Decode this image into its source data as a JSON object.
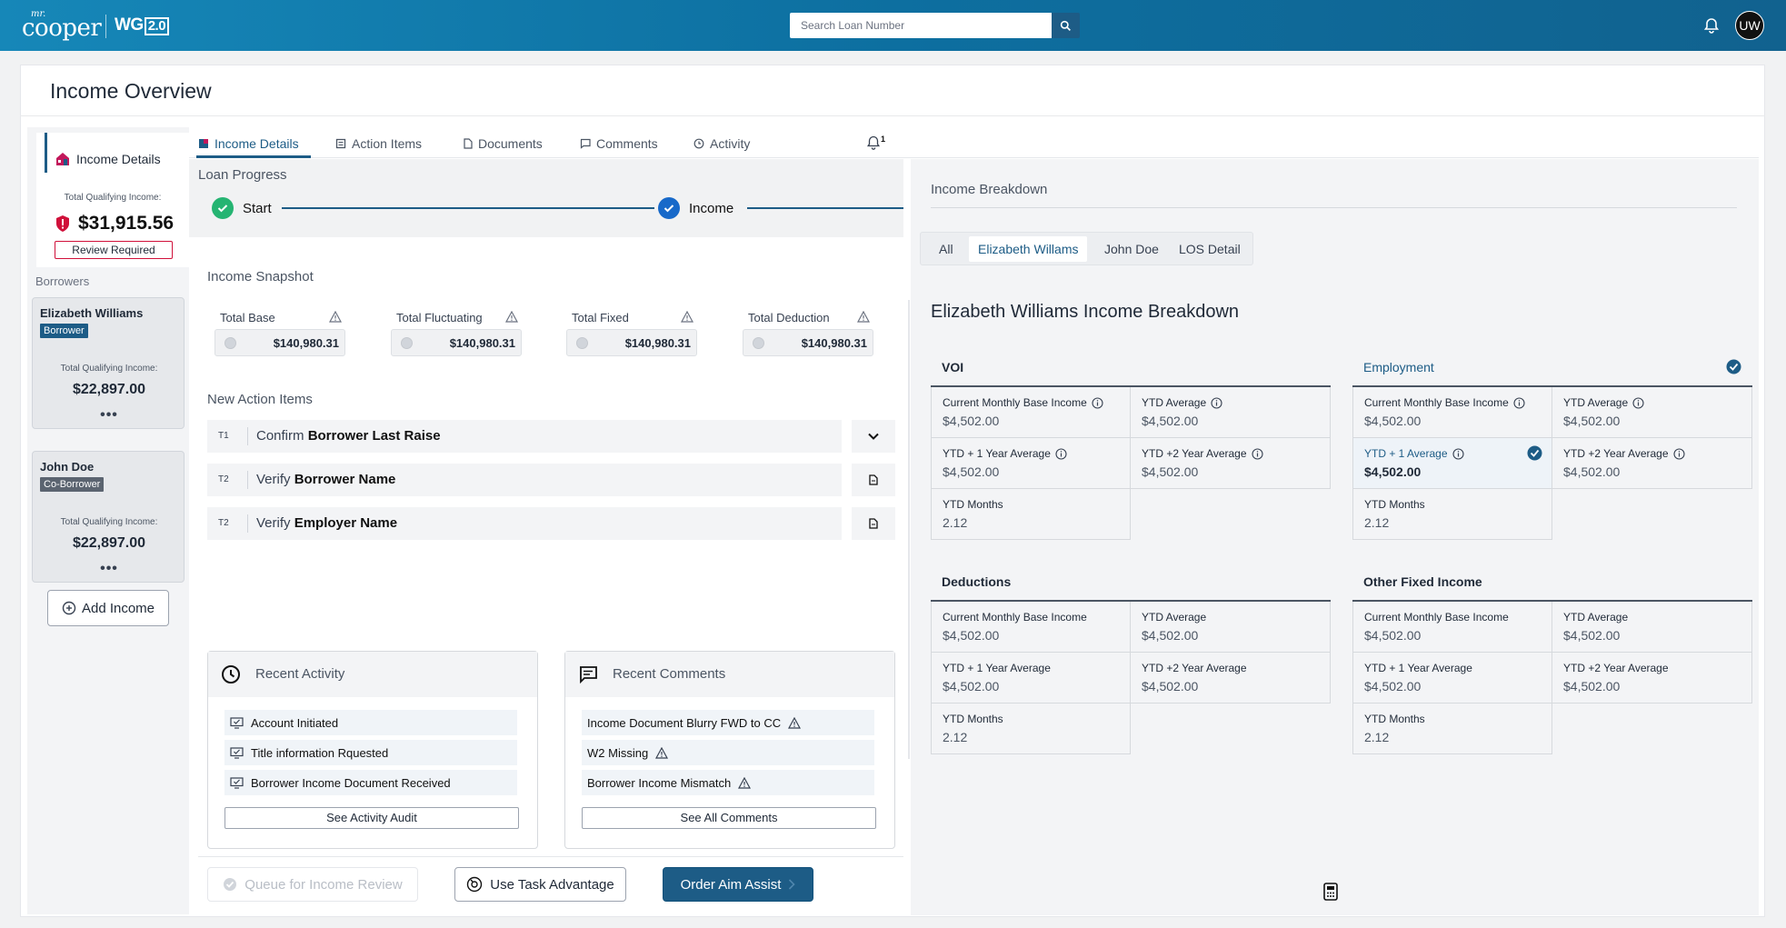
{
  "header": {
    "logo_mr": "mr.",
    "logo_cooper": "cooper",
    "product": "WG",
    "product_version": "2.0",
    "search_placeholder": "Search Loan Number",
    "user_initials": "UW"
  },
  "page": {
    "title": "Income Overview"
  },
  "sidebar": {
    "section_title": "Income Details",
    "tqi_label": "Total Qualifying Income:",
    "tqi_amount": "$31,915.56",
    "review_status": "Review Required",
    "borrowers_label": "Borrowers",
    "borrowers": [
      {
        "name": "Elizabeth Williams",
        "role": "Borrower",
        "tqi_label": "Total Qualifying Income:",
        "amount": "$22,897.00",
        "more": "•••"
      },
      {
        "name": "John Doe",
        "role": "Co-Borrower",
        "tqi_label": "Total Qualifying Income:",
        "amount": "$22,897.00",
        "more": "•••"
      }
    ],
    "add_income_label": "Add Income"
  },
  "tabs": [
    {
      "label": "Income Details",
      "active": true
    },
    {
      "label": "Action  Items",
      "active": false
    },
    {
      "label": "Documents",
      "active": false
    },
    {
      "label": "Comments",
      "active": false
    },
    {
      "label": "Activity",
      "active": false
    }
  ],
  "notifications": {
    "count": "1"
  },
  "loan_progress": {
    "title": "Loan Progress",
    "steps": [
      {
        "label": "Start",
        "status": "complete"
      },
      {
        "label": "Income",
        "status": "current"
      }
    ]
  },
  "income_snapshot": {
    "title": "Income Snapshot",
    "items": [
      {
        "label": "Total Base",
        "value": "$140,980.31"
      },
      {
        "label": "Total Fluctuating",
        "value": "$140,980.31"
      },
      {
        "label": "Total Fixed",
        "value": "$140,980.31"
      },
      {
        "label": "Total Deduction",
        "value": "$140,980.31"
      }
    ]
  },
  "action_items": {
    "title": "New Action Items",
    "items": [
      {
        "tag": "T1",
        "verb": "Confirm",
        "object": "Borrower Last Raise",
        "action_icon": "chevron-down-icon"
      },
      {
        "tag": "T2",
        "verb": "Verify",
        "object": "Borrower Name",
        "action_icon": "document-icon"
      },
      {
        "tag": "T2",
        "verb": "Verify",
        "object": "Employer Name",
        "action_icon": "document-icon"
      }
    ]
  },
  "recent_activity": {
    "title": "Recent  Activity",
    "items": [
      "Account Initiated",
      "Title information Rquested",
      "Borrower Income Document Received"
    ],
    "button": "See Activity Audit"
  },
  "recent_comments": {
    "title": "Recent Comments",
    "items": [
      "Income Document Blurry FWD to CC",
      "W2 Missing",
      "Borrower Income Mismatch"
    ],
    "button": "See All Comments"
  },
  "footer_actions": {
    "queue_label": "Queue for Income Review",
    "task_label": "Use Task Advantage",
    "aim_label": "Order Aim Assist"
  },
  "income_breakdown": {
    "title": "Income Breakdown",
    "filters": [
      {
        "label": "All",
        "active": false
      },
      {
        "label": "Elizabeth Willams",
        "active": true
      },
      {
        "label": "John Doe",
        "active": false
      },
      {
        "label": "LOS Detail",
        "active": false
      }
    ],
    "heading": "Elizabeth Williams Income Breakdown",
    "groups": [
      {
        "title": "VOI",
        "verified": false,
        "cells": [
          {
            "label": "Current Monthly Base Income",
            "value": "$4,502.00",
            "info": true
          },
          {
            "label": "YTD Average",
            "value": "$4,502.00",
            "info": true
          },
          {
            "label": "YTD + 1 Year Average",
            "value": "$4,502.00",
            "info": true
          },
          {
            "label": "YTD +2 Year Average",
            "value": "$4,502.00",
            "info": true
          },
          {
            "label": "YTD Months",
            "value": "2.12",
            "info": false
          }
        ]
      },
      {
        "title": "Employment",
        "verified": true,
        "cells": [
          {
            "label": "Current Monthly Base Income",
            "value": "$4,502.00",
            "info": true
          },
          {
            "label": "YTD Average",
            "value": "$4,502.00",
            "info": true
          },
          {
            "label": "YTD + 1 Average",
            "value": "$4,502.00",
            "info": true,
            "selected": true
          },
          {
            "label": "YTD +2 Year Average",
            "value": "$4,502.00",
            "info": true
          },
          {
            "label": "YTD Months",
            "value": "2.12",
            "info": false
          }
        ]
      },
      {
        "title": "Deductions",
        "verified": false,
        "cells": [
          {
            "label": "Current Monthly Base Income",
            "value": "$4,502.00",
            "info": false
          },
          {
            "label": "YTD Average",
            "value": "$4,502.00",
            "info": false
          },
          {
            "label": "YTD + 1 Year Average",
            "value": "$4,502.00",
            "info": false
          },
          {
            "label": "YTD +2 Year Average",
            "value": "$4,502.00",
            "info": false
          },
          {
            "label": "YTD Months",
            "value": "2.12",
            "info": false
          }
        ]
      },
      {
        "title": "Other Fixed Income",
        "verified": false,
        "cells": [
          {
            "label": "Current Monthly Base Income",
            "value": "$4,502.00",
            "info": false
          },
          {
            "label": "YTD Average",
            "value": "$4,502.00",
            "info": false
          },
          {
            "label": "YTD + 1 Year Average",
            "value": "$4,502.00",
            "info": false
          },
          {
            "label": "YTD +2 Year Average",
            "value": "$4,502.00",
            "info": false
          },
          {
            "label": "YTD Months",
            "value": "2.12",
            "info": false
          }
        ]
      }
    ]
  },
  "colors": {
    "brand": "#1d5c86",
    "topbar": "#0d6fa0",
    "success": "#25b472",
    "alert": "#d0103a",
    "progress_current": "#1769c9"
  }
}
